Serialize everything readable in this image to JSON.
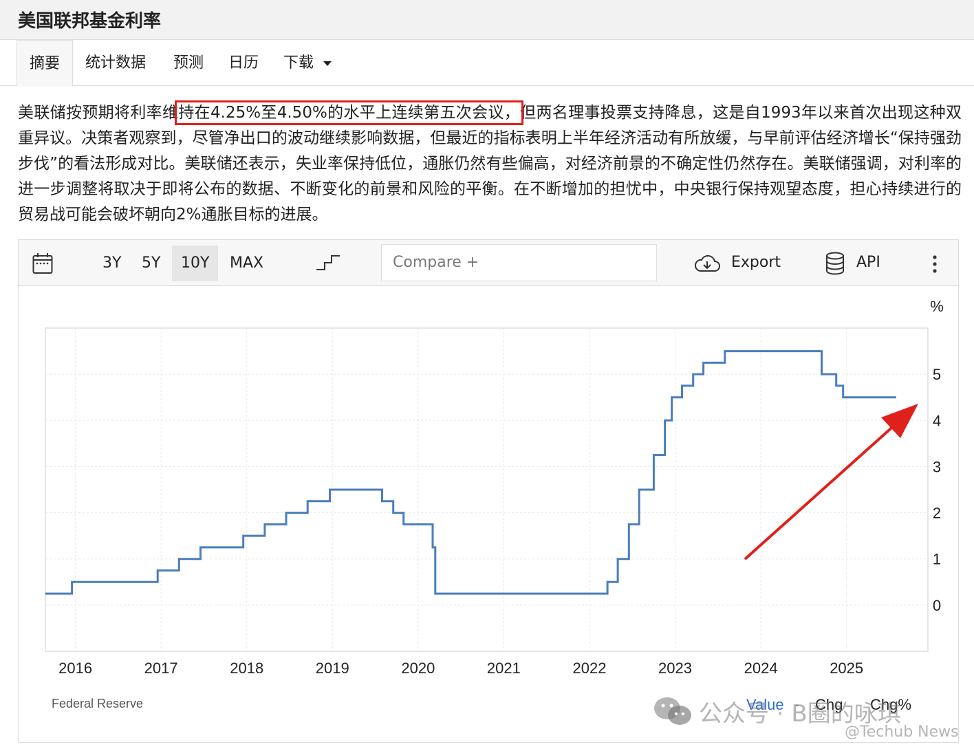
{
  "page": {
    "title": "美国联邦基金利率"
  },
  "tabs": [
    {
      "label": "摘要",
      "active": true
    },
    {
      "label": "统计数据"
    },
    {
      "label": "预测"
    },
    {
      "label": "日历"
    },
    {
      "label": "下载",
      "dropdown": true
    }
  ],
  "summary": {
    "before": "美联储按预期将利率维",
    "highlighted": "持在4.25%至4.50%的水平上连续第五次会议，",
    "after": "但两名理事投票支持降息，这是自1993年以来首次出现这种双重异议。决策者观察到，尽管净出口的波动继续影响数据，但最近的指标表明上半年经济活动有所放缓，与早前评估经济增长“保持强劲步伐”的看法形成对比。美联储还表示，失业率保持低位，通胀仍然有些偏高，对经济前景的不确定性仍然存在。美联储强调，对利率的进一步调整将取决于即将公布的数据、不断变化的前景和风险的平衡。在不断增加的担忧中，中央银行保持观望态度，担心持续进行的贸易战可能会破坏朝向2%通胀目标的进展。"
  },
  "toolbar": {
    "calendar_icon": "calendar-icon",
    "ranges": [
      "3Y",
      "5Y",
      "10Y",
      "MAX"
    ],
    "selected_range": "10Y",
    "chart_type_icon": "step-line-icon",
    "compare_label": "Compare +",
    "export_label": "Export",
    "export_icon": "cloud-download-icon",
    "api_label": "API",
    "api_icon": "database-icon",
    "menu_icon": "vertical-dots-icon"
  },
  "chart_data": {
    "type": "line",
    "step": true,
    "ylabel": "%",
    "ylim": [
      -1,
      6
    ],
    "xlim": [
      2015.65,
      2025.95
    ],
    "y_ticks": [
      0,
      1,
      2,
      3,
      4,
      5
    ],
    "x_ticks": [
      2016,
      2017,
      2018,
      2019,
      2020,
      2021,
      2022,
      2023,
      2024,
      2025
    ],
    "grid": true,
    "line_color": "#4a7ebb",
    "series": [
      {
        "points": [
          [
            2015.65,
            0.25
          ],
          [
            2015.96,
            0.5
          ],
          [
            2016.96,
            0.75
          ],
          [
            2017.21,
            1.0
          ],
          [
            2017.46,
            1.25
          ],
          [
            2017.96,
            1.5
          ],
          [
            2018.21,
            1.75
          ],
          [
            2018.46,
            2.0
          ],
          [
            2018.71,
            2.25
          ],
          [
            2018.97,
            2.5
          ],
          [
            2019.58,
            2.25
          ],
          [
            2019.71,
            2.0
          ],
          [
            2019.83,
            1.75
          ],
          [
            2020.17,
            1.25
          ],
          [
            2020.2,
            0.25
          ],
          [
            2022.21,
            0.5
          ],
          [
            2022.33,
            1.0
          ],
          [
            2022.46,
            1.75
          ],
          [
            2022.58,
            2.5
          ],
          [
            2022.75,
            3.25
          ],
          [
            2022.88,
            4.0
          ],
          [
            2022.96,
            4.5
          ],
          [
            2023.08,
            4.75
          ],
          [
            2023.21,
            5.0
          ],
          [
            2023.33,
            5.25
          ],
          [
            2023.58,
            5.5
          ],
          [
            2024.71,
            5.0
          ],
          [
            2024.88,
            4.75
          ],
          [
            2024.96,
            4.5
          ],
          [
            2025.58,
            4.5
          ]
        ]
      }
    ],
    "source": "Federal Reserve",
    "footer": [
      "Value",
      "·",
      "Chg",
      "Chg%"
    ]
  },
  "annotation": {
    "arrow_color": "#e0201a",
    "highlight_color": "#e0201a"
  },
  "watermark": {
    "text1": "公众号 · B圈的咏琪",
    "text2": "@Techub News"
  }
}
